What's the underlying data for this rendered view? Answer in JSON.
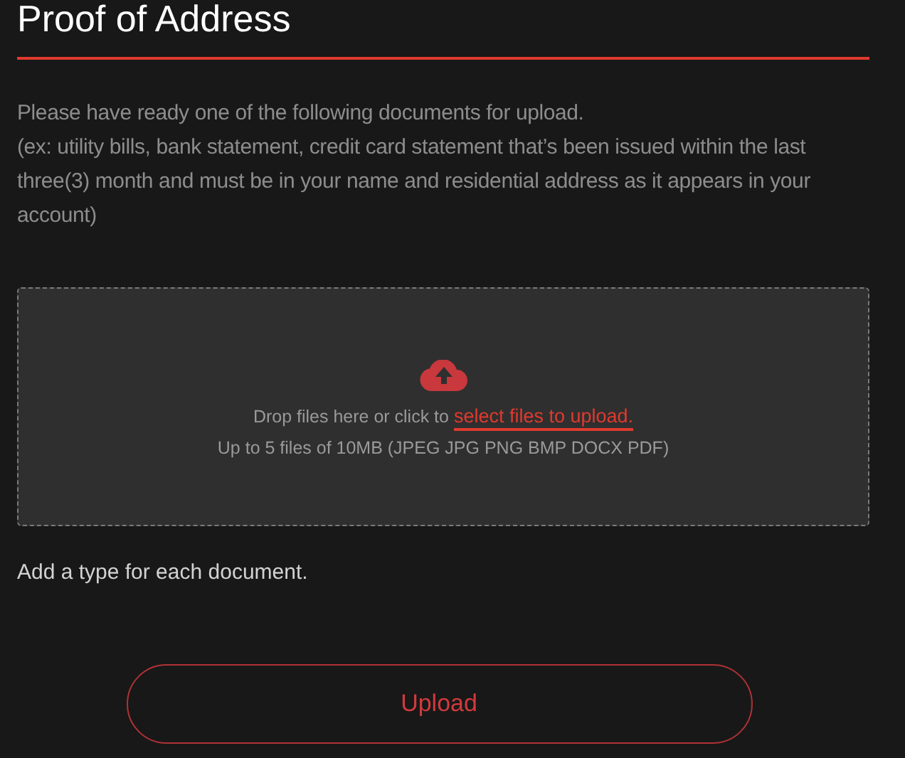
{
  "title": "Proof of Address",
  "instructions": [
    "Please have ready one of the following documents for upload.",
    "(ex: utility bills, bank statement, credit card statement that’s been issued within the last three(3) month and must be in your name and residential address as it appears in your account)"
  ],
  "dropzone": {
    "prompt": "Drop files here or click to",
    "link": "select files to upload.",
    "limits": "Up to 5 files of 10MB (JPEG JPG PNG BMP DOCX PDF)"
  },
  "note": "Add a type for each document.",
  "buttons": [
    {
      "label": "Upload"
    }
  ]
}
